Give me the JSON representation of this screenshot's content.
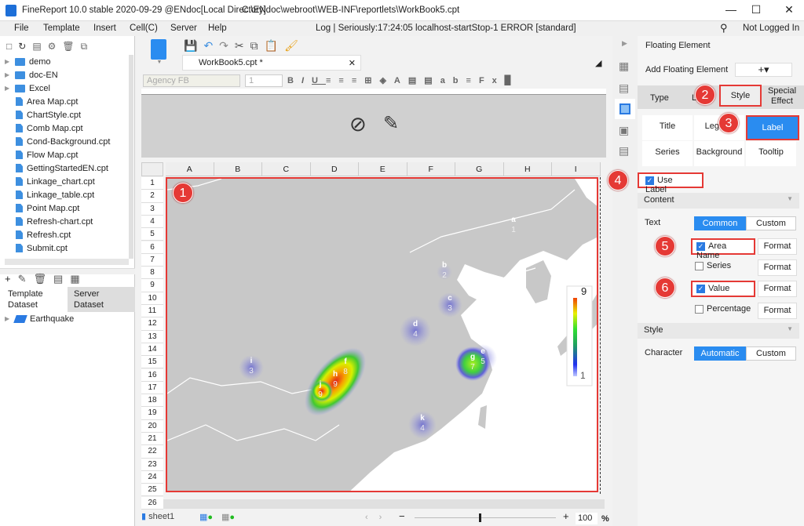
{
  "window": {
    "title": "FineReport 10.0 stable 2020-09-29 @ENdoc[Local Directory]",
    "path": "C:\\ENdoc\\webroot\\WEB-INF\\reportlets\\WorkBook5.cpt",
    "minimize": "—",
    "maximize": "☐",
    "close": "✕"
  },
  "menu": {
    "items": [
      "File",
      "Template",
      "Insert",
      "Cell(C)",
      "Server",
      "Help"
    ],
    "log": "Log | Seriously:17:24:05 localhost-startStop-1 ERROR [standard]",
    "login": "Not Logged In"
  },
  "tree": {
    "folders": [
      "demo",
      "doc-EN",
      "Excel"
    ],
    "files": [
      "Area Map.cpt",
      "ChartStyle.cpt",
      "Comb Map.cpt",
      "Cond-Background.cpt",
      "Flow Map.cpt",
      "GettingStartedEN.cpt",
      "Linkage_chart.cpt",
      "Linkage_table.cpt",
      "Point Map.cpt",
      "Refresh-chart.cpt",
      "Refresh.cpt",
      "Submit.cpt"
    ]
  },
  "dataset": {
    "tabs": [
      "Template Dataset",
      "Server Dataset"
    ],
    "items": [
      "Earthquake"
    ]
  },
  "editor": {
    "tab": "WorkBook5.cpt *",
    "font": "Agency FB",
    "size": "1",
    "columns": [
      "A",
      "B",
      "C",
      "D",
      "E",
      "F",
      "G",
      "H",
      "I"
    ],
    "rows": [
      "1",
      "2",
      "3",
      "4",
      "5",
      "6",
      "7",
      "8",
      "9",
      "10",
      "11",
      "12",
      "13",
      "14",
      "15",
      "16",
      "17",
      "18",
      "19",
      "20",
      "21",
      "22",
      "23",
      "24",
      "25",
      "26"
    ],
    "sheet": "sheet1",
    "zoom": "100",
    "zoom_unit": "%"
  },
  "map": {
    "points": [
      {
        "name": "a",
        "value": "1"
      },
      {
        "name": "b",
        "value": "2"
      },
      {
        "name": "c",
        "value": "3"
      },
      {
        "name": "d",
        "value": "4"
      },
      {
        "name": "e",
        "value": "5"
      },
      {
        "name": "f",
        "value": "8"
      },
      {
        "name": "g",
        "value": "7"
      },
      {
        "name": "h",
        "value": "9"
      },
      {
        "name": "i",
        "value": "3"
      },
      {
        "name": "j",
        "value": "9"
      },
      {
        "name": "k",
        "value": "4"
      }
    ],
    "legend": {
      "max": "9",
      "min": "1"
    },
    "land_color": "#c8c8c8"
  },
  "annotations": [
    "1",
    "2",
    "3",
    "4",
    "5",
    "6"
  ],
  "panel": {
    "header": "Floating Element",
    "add_label": "Add Floating Element",
    "add_btn": "+▾",
    "tabs": [
      "Type",
      "L",
      "Style",
      "Special Effect"
    ],
    "subtabs": [
      "Title",
      "Legend",
      "Label",
      "Series",
      "Background",
      "Tooltip"
    ],
    "use_label": "Use Label",
    "content": "Content",
    "text": "Text",
    "text_modes": [
      "Common",
      "Custom"
    ],
    "options": [
      {
        "label": "Area Name",
        "checked": true
      },
      {
        "label": "Series",
        "checked": false
      },
      {
        "label": "Value",
        "checked": true
      },
      {
        "label": "Percentage",
        "checked": false
      }
    ],
    "format": "Format",
    "style": "Style",
    "character": "Character",
    "char_modes": [
      "Automatic",
      "Custom"
    ],
    "accent": "#2a8cf0"
  }
}
